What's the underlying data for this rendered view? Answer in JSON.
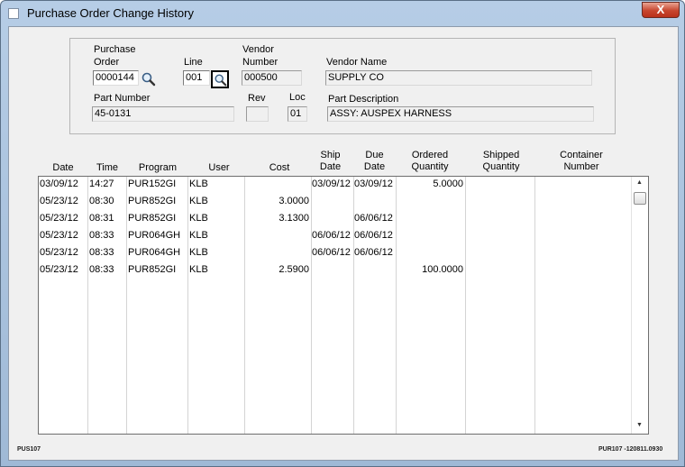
{
  "window": {
    "title": "Purchase Order Change History",
    "close_label": "X"
  },
  "header": {
    "po_label_1": "Purchase",
    "po_label_2": "Order",
    "po_value": "0000144",
    "line_label": "Line",
    "line_value": "001",
    "vendor_number_label_1": "Vendor",
    "vendor_number_label_2": "Number",
    "vendor_number_value": "000500",
    "vendor_name_label": "Vendor Name",
    "vendor_name_value": "SUPPLY CO",
    "part_number_label": "Part Number",
    "part_number_value": "45-0131",
    "rev_label": "Rev",
    "rev_value": "",
    "loc_label": "Loc",
    "loc_value": "01",
    "part_desc_label": "Part Description",
    "part_desc_value": "ASSY: AUSPEX HARNESS"
  },
  "table": {
    "columns": [
      {
        "l1": "",
        "l2": "Date"
      },
      {
        "l1": "",
        "l2": "Time"
      },
      {
        "l1": "",
        "l2": "Program"
      },
      {
        "l1": "",
        "l2": "User"
      },
      {
        "l1": "",
        "l2": "Cost"
      },
      {
        "l1": "Ship",
        "l2": "Date"
      },
      {
        "l1": "Due",
        "l2": "Date"
      },
      {
        "l1": "Ordered",
        "l2": "Quantity"
      },
      {
        "l1": "Shipped",
        "l2": "Quantity"
      },
      {
        "l1": "Container",
        "l2": "Number"
      }
    ],
    "rows": [
      {
        "date": "03/09/12",
        "time": "14:27",
        "program": "PUR152GI",
        "user": "KLB",
        "cost": "",
        "ship": "03/09/12",
        "due": "03/09/12",
        "ordered": "5.0000"
      },
      {
        "date": "05/23/12",
        "time": "08:30",
        "program": "PUR852GI",
        "user": "KLB",
        "cost": "3.0000",
        "ship": "",
        "due": "",
        "ordered": ""
      },
      {
        "date": "05/23/12",
        "time": "08:31",
        "program": "PUR852GI",
        "user": "KLB",
        "cost": "3.1300",
        "ship": "",
        "due": "06/06/12",
        "ordered": ""
      },
      {
        "date": "05/23/12",
        "time": "08:33",
        "program": "PUR064GH",
        "user": "KLB",
        "cost": "",
        "ship": "06/06/12",
        "due": "06/06/12",
        "ordered": ""
      },
      {
        "date": "05/23/12",
        "time": "08:33",
        "program": "PUR064GH",
        "user": "KLB",
        "cost": "",
        "ship": "06/06/12",
        "due": "06/06/12",
        "ordered": ""
      },
      {
        "date": "05/23/12",
        "time": "08:33",
        "program": "PUR852GI",
        "user": "KLB",
        "cost": "2.5900",
        "ship": "",
        "due": "",
        "ordered": "100.0000"
      }
    ]
  },
  "footer": {
    "left": "PUS107",
    "right": "PUR107 -120811.0930"
  },
  "icons": {
    "lookup": "magnifier-icon",
    "close": "close-icon"
  },
  "colors": {
    "title_bar": "#b6cde6",
    "close_button": "#c7462f",
    "background": "#f0f0f0"
  }
}
